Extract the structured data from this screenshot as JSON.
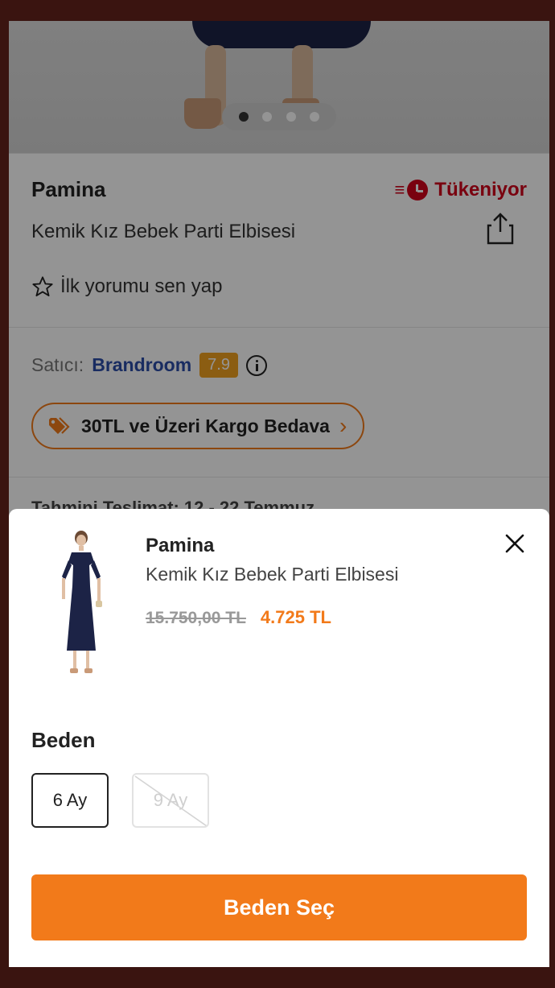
{
  "background": {
    "brand": "Pamina",
    "stock_label": "Tükeniyor",
    "product_name": "Kemik Kız Bebek Parti Elbisesi",
    "review_label": "İlk yorumu sen yap",
    "seller_prefix": "Satıcı:",
    "seller_name": "Brandroom",
    "seller_score": "7.9",
    "cargo_label": "30TL ve Üzeri Kargo Bedava",
    "delivery_label": "Tahmini Teslimat: 12 - 22 Temmuz",
    "image_dots": 4,
    "active_dot": 0
  },
  "sheet": {
    "brand": "Pamina",
    "product_name": "Kemik Kız Bebek Parti Elbisesi",
    "old_price": "15.750,00 TL",
    "new_price": "4.725 TL",
    "size_title": "Beden",
    "sizes": [
      {
        "label": "6 Ay",
        "state": "selected"
      },
      {
        "label": "9 Ay",
        "state": "unavailable"
      }
    ],
    "cta_label": "Beden Seç"
  },
  "colors": {
    "accent": "#f27a1a",
    "stock_red": "#d0021b",
    "seller_blue": "#2b4da8",
    "score_badge": "#f0a020",
    "frame": "#3a1410"
  },
  "icons": [
    "share-icon",
    "star-icon",
    "info-icon",
    "tag-icon",
    "chevron-right-icon",
    "close-icon",
    "clock-icon"
  ]
}
